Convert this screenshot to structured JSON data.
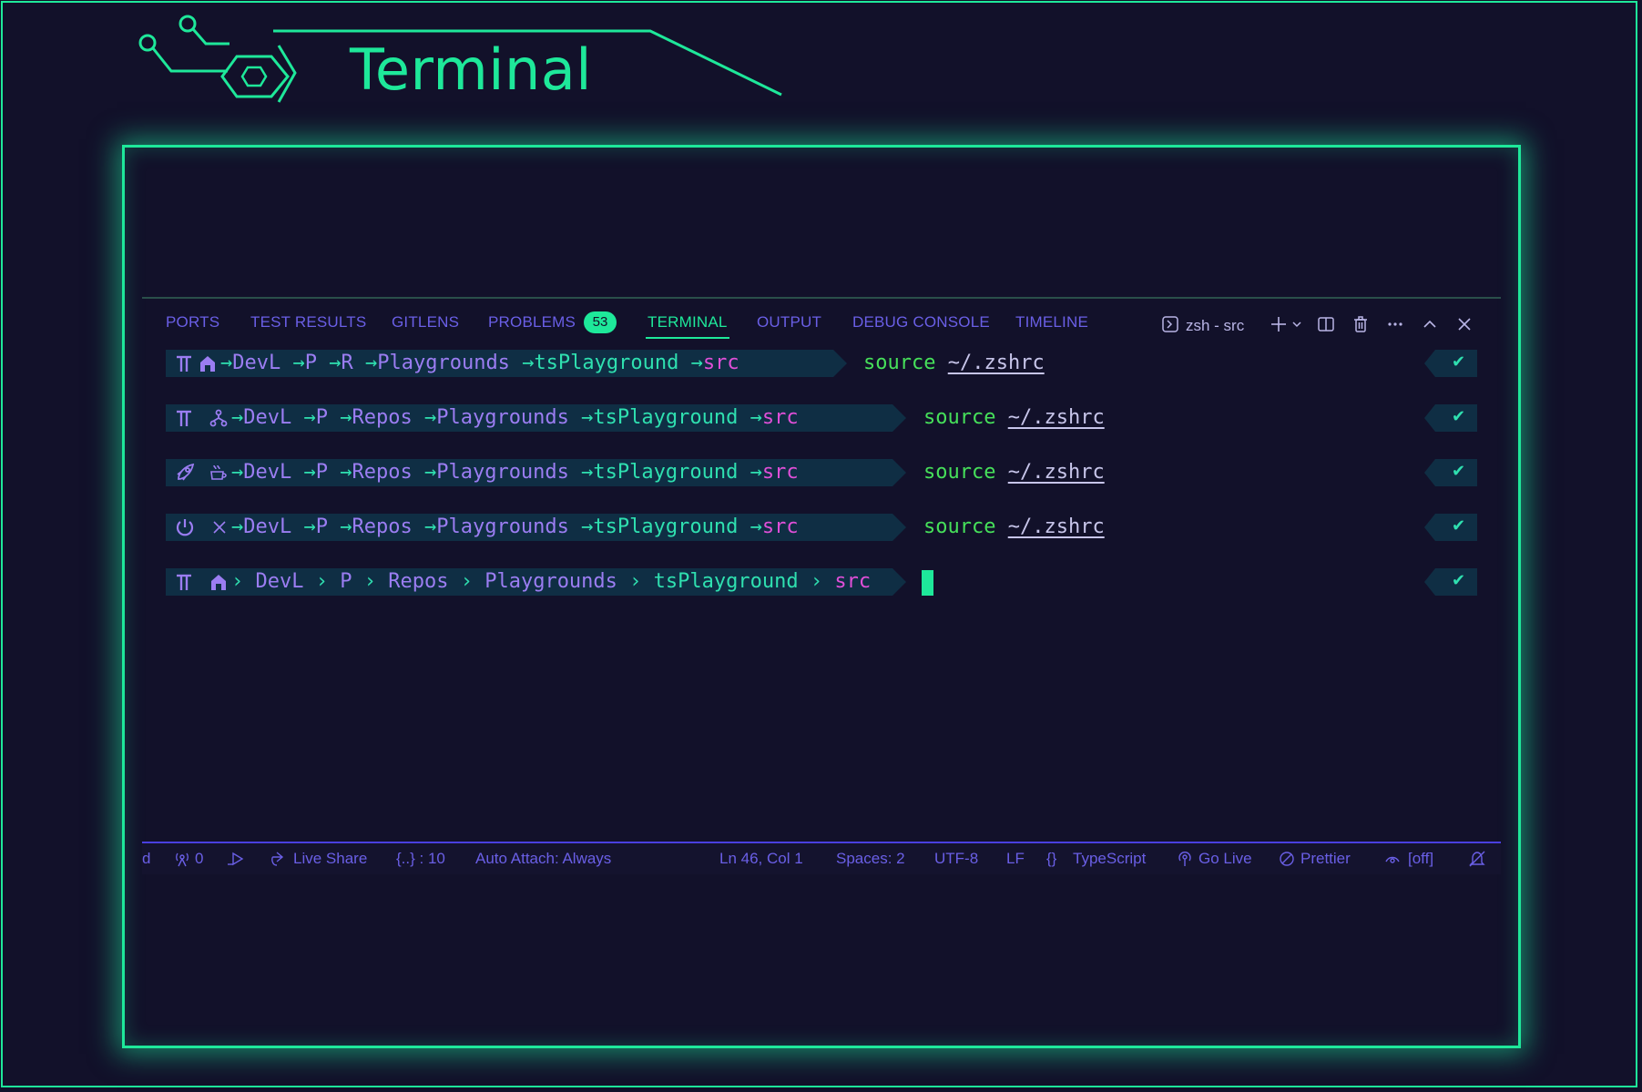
{
  "page": {
    "title": "Terminal"
  },
  "colors": {
    "accent": "#1ee89a",
    "tab": "#6a5fe6",
    "background": "#12112a",
    "prompt_bg": "#0f2e44"
  },
  "panel": {
    "tabs": [
      {
        "label": "PORTS"
      },
      {
        "label": "TEST RESULTS"
      },
      {
        "label": "GITLENS"
      },
      {
        "label": "PROBLEMS",
        "badge": "53"
      },
      {
        "label": "TERMINAL",
        "active": true
      },
      {
        "label": "OUTPUT"
      },
      {
        "label": "DEBUG CONSOLE"
      },
      {
        "label": "TIMELINE"
      }
    ],
    "terminal_name": "zsh - src",
    "toolbar_icons": [
      "terminal-icon",
      "plus-icon",
      "chevron-down-icon",
      "split-icon",
      "trash-icon",
      "more-icon",
      "chevron-up-icon",
      "close-icon"
    ]
  },
  "prompts": [
    {
      "icons": [
        "tee-icon",
        "home-icon"
      ],
      "path": [
        "DevL",
        "P",
        "R",
        "Playgrounds",
        "tsPlayground",
        "src"
      ],
      "separator": "→",
      "command": "source",
      "arg": "~/.zshrc",
      "status": "✔"
    },
    {
      "icons": [
        "tee-icon",
        "git-branch-icon"
      ],
      "path": [
        "DevL",
        "P",
        "Repos",
        "Playgrounds",
        "tsPlayground",
        "src"
      ],
      "separator": "→",
      "command": "source",
      "arg": "~/.zshrc",
      "status": "✔"
    },
    {
      "icons": [
        "rocket-icon",
        "coffee-icon"
      ],
      "path": [
        "DevL",
        "P",
        "Repos",
        "Playgrounds",
        "tsPlayground",
        "src"
      ],
      "separator": "→",
      "command": "source",
      "arg": "~/.zshrc",
      "status": "✔"
    },
    {
      "icons": [
        "power-icon",
        "cross-icon"
      ],
      "path": [
        "DevL",
        "P",
        "Repos",
        "Playgrounds",
        "tsPlayground",
        "src"
      ],
      "separator": "→",
      "command": "source",
      "arg": "~/.zshrc",
      "status": "✔"
    },
    {
      "icons": [
        "tee-icon",
        "home-icon"
      ],
      "path": [
        "DevL",
        "P",
        "Repos",
        "Playgrounds",
        "tsPlayground",
        "src"
      ],
      "separator": "›",
      "command": "",
      "arg": "",
      "status": "✔"
    }
  ],
  "statusbar": {
    "left_fragment": "d",
    "ports_count": "0",
    "live_share": "Live Share",
    "json_count": "{..} : 10",
    "auto_attach": "Auto Attach: Always",
    "position": "Ln 46, Col 1",
    "spaces": "Spaces: 2",
    "encoding": "UTF-8",
    "eol": "LF",
    "language": "TypeScript",
    "go_live": "Go Live",
    "prettier": "Prettier",
    "copilot": "[off]"
  }
}
